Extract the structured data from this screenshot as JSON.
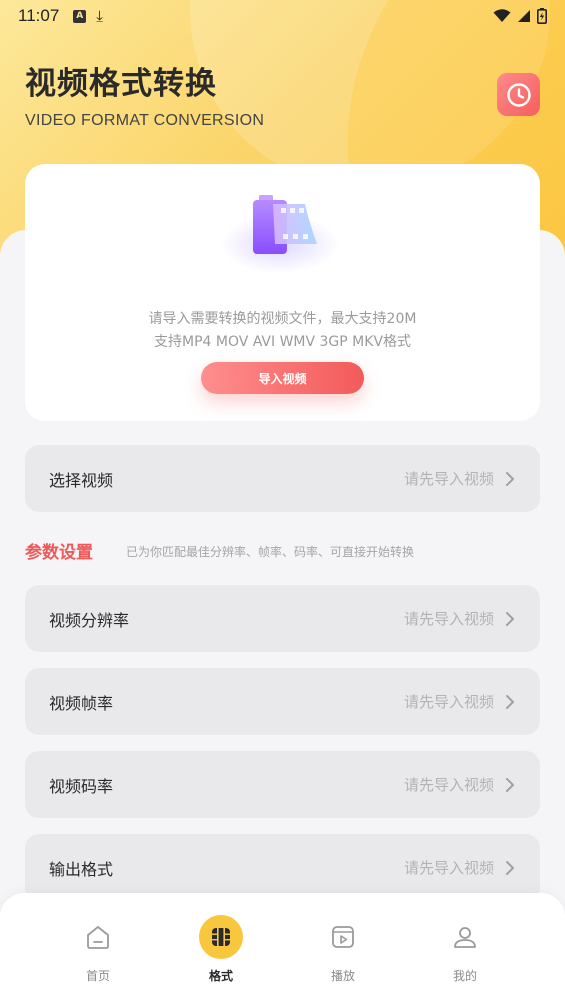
{
  "status_bar": {
    "time": "11:07",
    "left_icons": [
      "a-badge-icon",
      "download-icon"
    ],
    "right_icons": [
      "wifi-icon",
      "signal-icon",
      "battery-charging-icon"
    ]
  },
  "header": {
    "title": "视频格式转换",
    "subtitle": "VIDEO FORMAT CONVERSION",
    "history_icon": "clock-icon"
  },
  "upload": {
    "line1": "请导入需要转换的视频文件，最大支持20M",
    "line2": "支持MP4 MOV AVI WMV 3GP MKV格式",
    "button_label": "导入视频"
  },
  "select_video": {
    "label": "选择视频",
    "value": "请先导入视频"
  },
  "params": {
    "title": "参数设置",
    "hint": "已为你匹配最佳分辨率、帧率、码率、可直接开始转换",
    "rows": [
      {
        "label": "视频分辨率",
        "value": "请先导入视频"
      },
      {
        "label": "视频帧率",
        "value": "请先导入视频"
      },
      {
        "label": "视频码率",
        "value": "请先导入视频"
      },
      {
        "label": "输出格式",
        "value": "请先导入视频"
      }
    ]
  },
  "tabbar": {
    "items": [
      {
        "label": "首页",
        "icon": "home-icon",
        "active": false
      },
      {
        "label": "格式",
        "icon": "film-icon",
        "active": true
      },
      {
        "label": "播放",
        "icon": "play-icon",
        "active": false
      },
      {
        "label": "我的",
        "icon": "user-icon",
        "active": false
      }
    ]
  },
  "colors": {
    "accent_red": "#f35a5a",
    "accent_yellow": "#f9c73e",
    "section_title": "#ee5a5a"
  }
}
